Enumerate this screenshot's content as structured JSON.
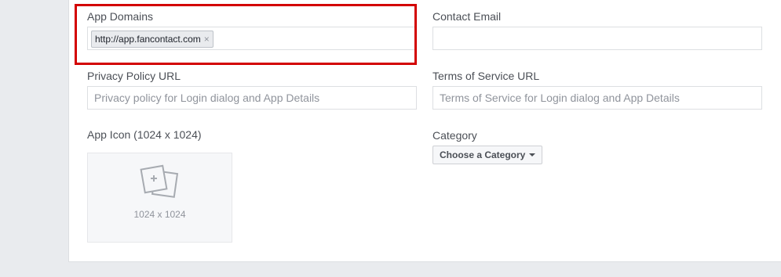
{
  "app_domains": {
    "label": "App Domains",
    "tags": [
      "http://app.fancontact.com"
    ],
    "remove_icon": "close-icon"
  },
  "contact_email": {
    "label": "Contact Email",
    "value": ""
  },
  "privacy_policy": {
    "label": "Privacy Policy URL",
    "placeholder": "Privacy policy for Login dialog and App Details"
  },
  "terms_of_service": {
    "label": "Terms of Service URL",
    "placeholder": "Terms of Service for Login dialog and App Details"
  },
  "app_icon": {
    "label": "App Icon (1024 x 1024)",
    "caption": "1024 x 1024",
    "icon": "add-picture-icon"
  },
  "category": {
    "label": "Category",
    "button_label": "Choose a Category",
    "icon": "caret-down-icon"
  },
  "colors": {
    "highlight": "#d30000",
    "page_background": "#e9ebee",
    "panel_background": "#ffffff"
  }
}
